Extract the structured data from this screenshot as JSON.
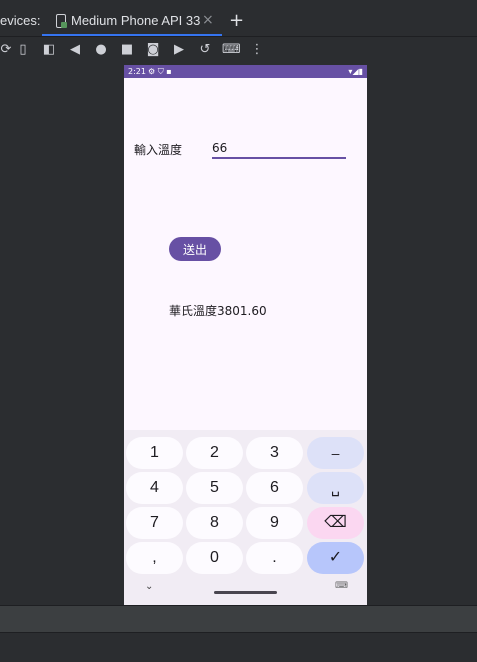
{
  "ide": {
    "tab_prefix": "evices:",
    "tab_label": "Medium Phone API 33",
    "tab_close": "×",
    "tab_add": "+"
  },
  "toolbar": {
    "icons": [
      "rotate-icon",
      "fold-icon",
      "fold-alt-icon",
      "back-icon",
      "home-icon",
      "overview-icon",
      "screenshot-icon",
      "record-icon",
      "restore-icon",
      "keyboard-icon",
      "more-icon"
    ]
  },
  "statusbar": {
    "time": "2:21",
    "icons": "⚙ ⛉ ▪",
    "right_icons": "▾◢▮"
  },
  "app": {
    "temp_label": "輸入溫度",
    "temp_value": "66",
    "send_label": "送出",
    "result_text": "華氏溫度3801.60"
  },
  "keyboard": {
    "rows": [
      [
        "1",
        "2",
        "3",
        "–"
      ],
      [
        "4",
        "5",
        "6",
        "␣"
      ],
      [
        "7",
        "8",
        "9",
        "⌫"
      ],
      [
        ",",
        "0",
        ".",
        "✓"
      ]
    ],
    "nav_chevron": "⌄",
    "nav_switch": "⌨"
  },
  "colors": {
    "accent": "#6750a4",
    "ide_tab_underline": "#3574f0",
    "phone_bg": "#fdf7ff"
  }
}
